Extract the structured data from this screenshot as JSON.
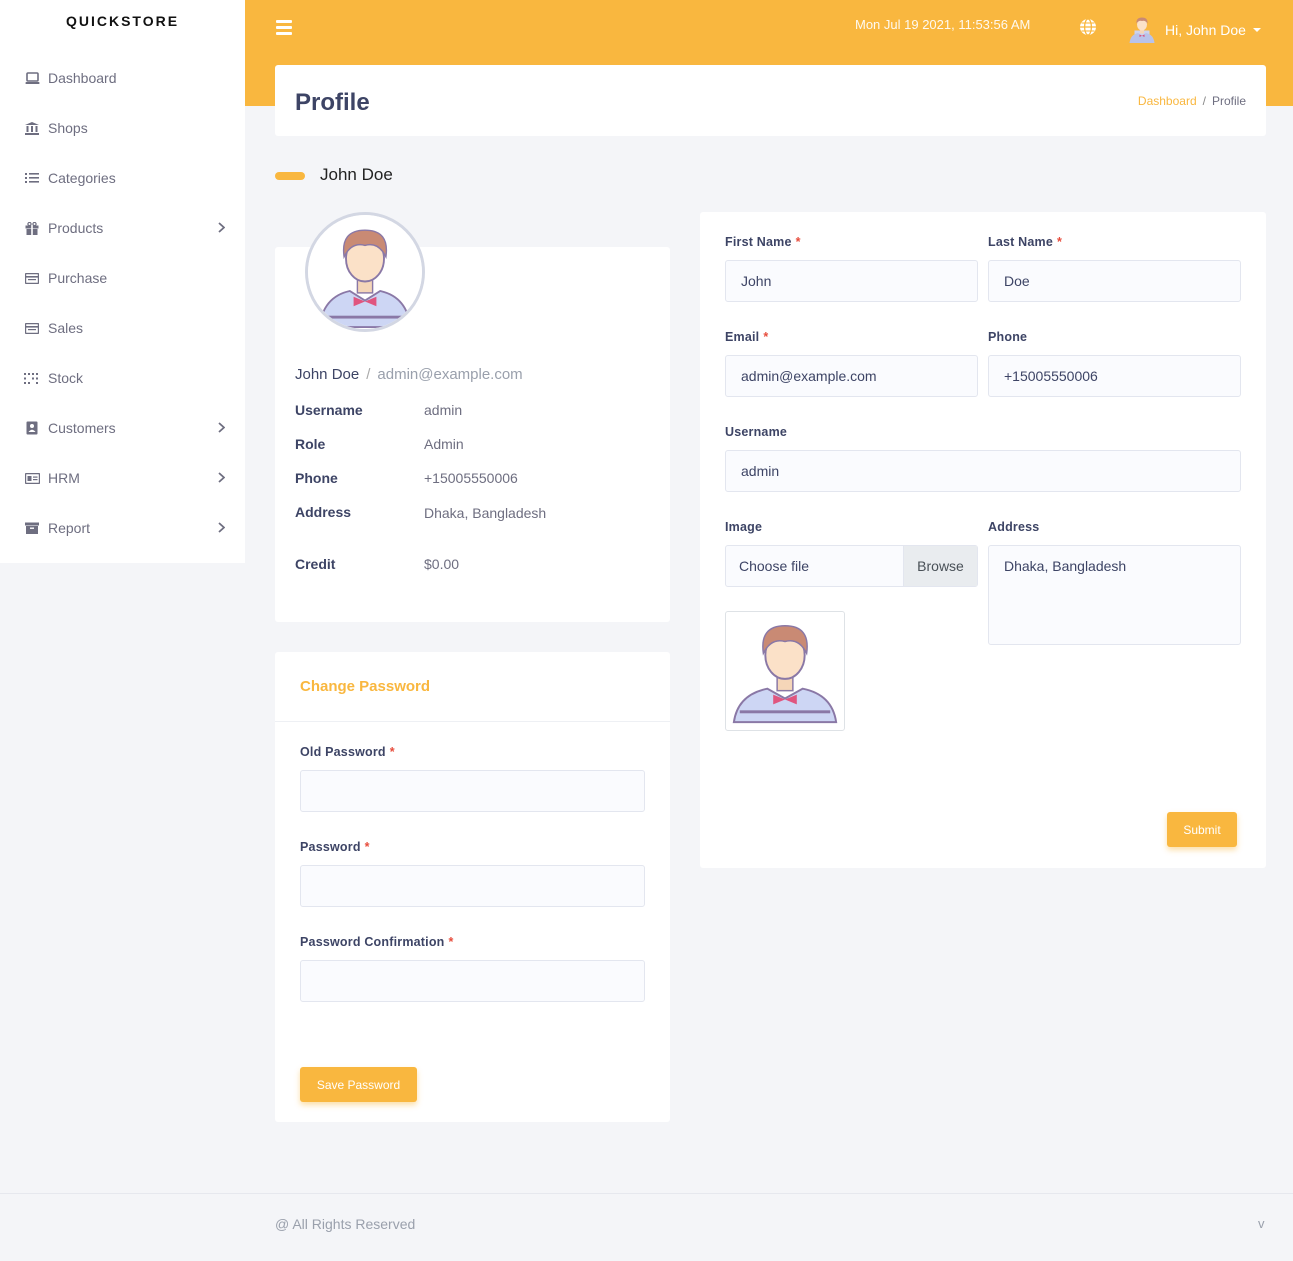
{
  "brand": "QUICKSTORE",
  "sidebar": {
    "items": [
      {
        "label": "Dashboard",
        "icon": "laptop-icon",
        "has_submenu": false
      },
      {
        "label": "Shops",
        "icon": "bank-icon",
        "has_submenu": false
      },
      {
        "label": "Categories",
        "icon": "list-icon",
        "has_submenu": false
      },
      {
        "label": "Products",
        "icon": "gift-icon",
        "has_submenu": true
      },
      {
        "label": "Purchase",
        "icon": "receipt-icon",
        "has_submenu": false
      },
      {
        "label": "Sales",
        "icon": "receipt-icon",
        "has_submenu": false
      },
      {
        "label": "Stock",
        "icon": "grid-dots-icon",
        "has_submenu": false
      },
      {
        "label": "Customers",
        "icon": "contact-book-icon",
        "has_submenu": true
      },
      {
        "label": "HRM",
        "icon": "id-card-icon",
        "has_submenu": true
      },
      {
        "label": "Report",
        "icon": "archive-icon",
        "has_submenu": true
      }
    ]
  },
  "header": {
    "datetime": "Mon Jul 19 2021, 11:53:56 AM",
    "user_greeting": "Hi, John Doe"
  },
  "page": {
    "title": "Profile",
    "breadcrumb": {
      "link": "Dashboard",
      "separator": "/",
      "current": "Profile"
    },
    "section_heading": "John Doe"
  },
  "profile": {
    "name": "John Doe",
    "separator": "/",
    "email": "admin@example.com",
    "fields": [
      {
        "label": "Username",
        "value": "admin"
      },
      {
        "label": "Role",
        "value": "Admin"
      },
      {
        "label": "Phone",
        "value": "+15005550006"
      },
      {
        "label": "Address",
        "value": "Dhaka, Bangladesh"
      },
      {
        "label": "Credit",
        "value": "$0.00"
      }
    ]
  },
  "change_password": {
    "title": "Change Password",
    "old_password_label": "Old Password",
    "password_label": "Password",
    "confirm_label": "Password Confirmation",
    "required_mark": "*",
    "save_button": "Save Password"
  },
  "edit_form": {
    "first_name_label": "First Name",
    "first_name_value": "John",
    "last_name_label": "Last Name",
    "last_name_value": "Doe",
    "email_label": "Email",
    "email_value": "admin@example.com",
    "phone_label": "Phone",
    "phone_value": "+15005550006",
    "username_label": "Username",
    "username_value": "admin",
    "image_label": "Image",
    "file_placeholder": "Choose file",
    "browse_label": "Browse",
    "address_label": "Address",
    "address_value": "Dhaka, Bangladesh",
    "required_mark": "*",
    "submit_button": "Submit"
  },
  "footer": {
    "text": "@ All Rights Reserved",
    "version": "v"
  },
  "colors": {
    "accent": "#f9b73f",
    "text_dark": "#3d4465",
    "required": "#e74c3c",
    "background": "#f4f5f8"
  }
}
